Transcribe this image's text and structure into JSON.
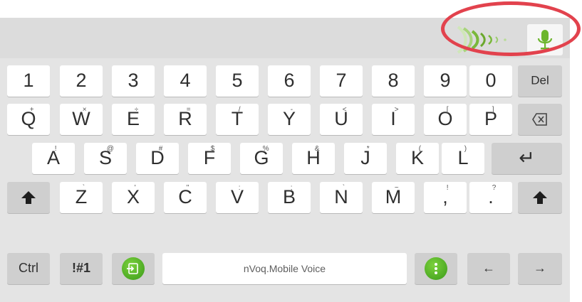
{
  "voice_bar": {
    "mic_icon": "microphone-icon",
    "waves_icon": "voice-waves-icon",
    "accent": "#7ab83a"
  },
  "row_numbers": {
    "keys": [
      "1",
      "2",
      "3",
      "4",
      "5",
      "6",
      "7",
      "8",
      "9",
      "0",
      "Del"
    ]
  },
  "row_qwerty": {
    "keys": [
      "Q",
      "W",
      "E",
      "R",
      "T",
      "Y",
      "U",
      "I",
      "O",
      "P"
    ],
    "subs": [
      "+",
      "×",
      "÷",
      "=",
      "/",
      "-",
      "<",
      ">",
      "[",
      "]"
    ],
    "backspace_icon": "backspace-icon"
  },
  "row_asdf": {
    "keys": [
      "A",
      "S",
      "D",
      "F",
      "G",
      "H",
      "J",
      "K",
      "L"
    ],
    "subs": [
      "!",
      "@",
      "#",
      "$",
      "%",
      "&",
      "*",
      "(",
      ")"
    ],
    "enter_glyph": "↵"
  },
  "row_zxcv": {
    "keys": [
      "Z",
      "X",
      "C",
      "V",
      "B",
      "N",
      "M",
      ",",
      "."
    ],
    "subs": [
      "`",
      "'",
      "\"",
      ":",
      ";",
      "`",
      "~",
      "!",
      "?"
    ],
    "shift_icon": "shift-icon"
  },
  "row_bottom": {
    "ctrl": "Ctrl",
    "symbols": "!#1",
    "app_icon": "nvoq-app-icon",
    "space": "nVoq.Mobile Voice",
    "menu_icon": "more-vertical-icon",
    "left_arrow": "←",
    "right_arrow": "→"
  },
  "colors": {
    "keyboard_bg": "#e4e4e4",
    "highlight_ring": "#e2424d",
    "green": "#4caf23"
  }
}
